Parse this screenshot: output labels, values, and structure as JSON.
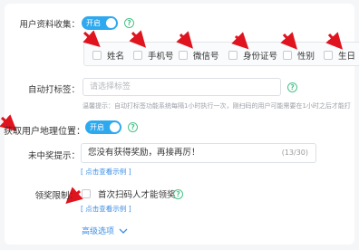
{
  "collect_profile": {
    "label": "用户资料收集：",
    "toggle_text": "开启",
    "options": [
      "姓名",
      "手机号",
      "微信号",
      "身份证号",
      "性别",
      "生日"
    ]
  },
  "auto_tag": {
    "label": "自动打标签：",
    "placeholder": "请选择标签",
    "hint": "温馨提示：自动打标签功能系统每隔1小时执行一次，刚扫码的用户可能需要在1小时之后才能打"
  },
  "location": {
    "label": "获取用户地理位置：",
    "toggle_text": "开启"
  },
  "no_prize": {
    "label": "未中奖提示：",
    "value": "您没有获得奖励，再接再厉！",
    "counter": "(13/30)",
    "example_link": "[ 点击查看示例 ]"
  },
  "claim_limit": {
    "label": "领奖限制：",
    "checkbox_label": "首次扫码人才能领奖",
    "example_link": "[ 点击查看示例 ]"
  },
  "advanced": {
    "label": "高级选项"
  },
  "colors": {
    "accent": "#2ea9ef",
    "help_green": "#48c288",
    "annotation_red": "#e0141e"
  }
}
